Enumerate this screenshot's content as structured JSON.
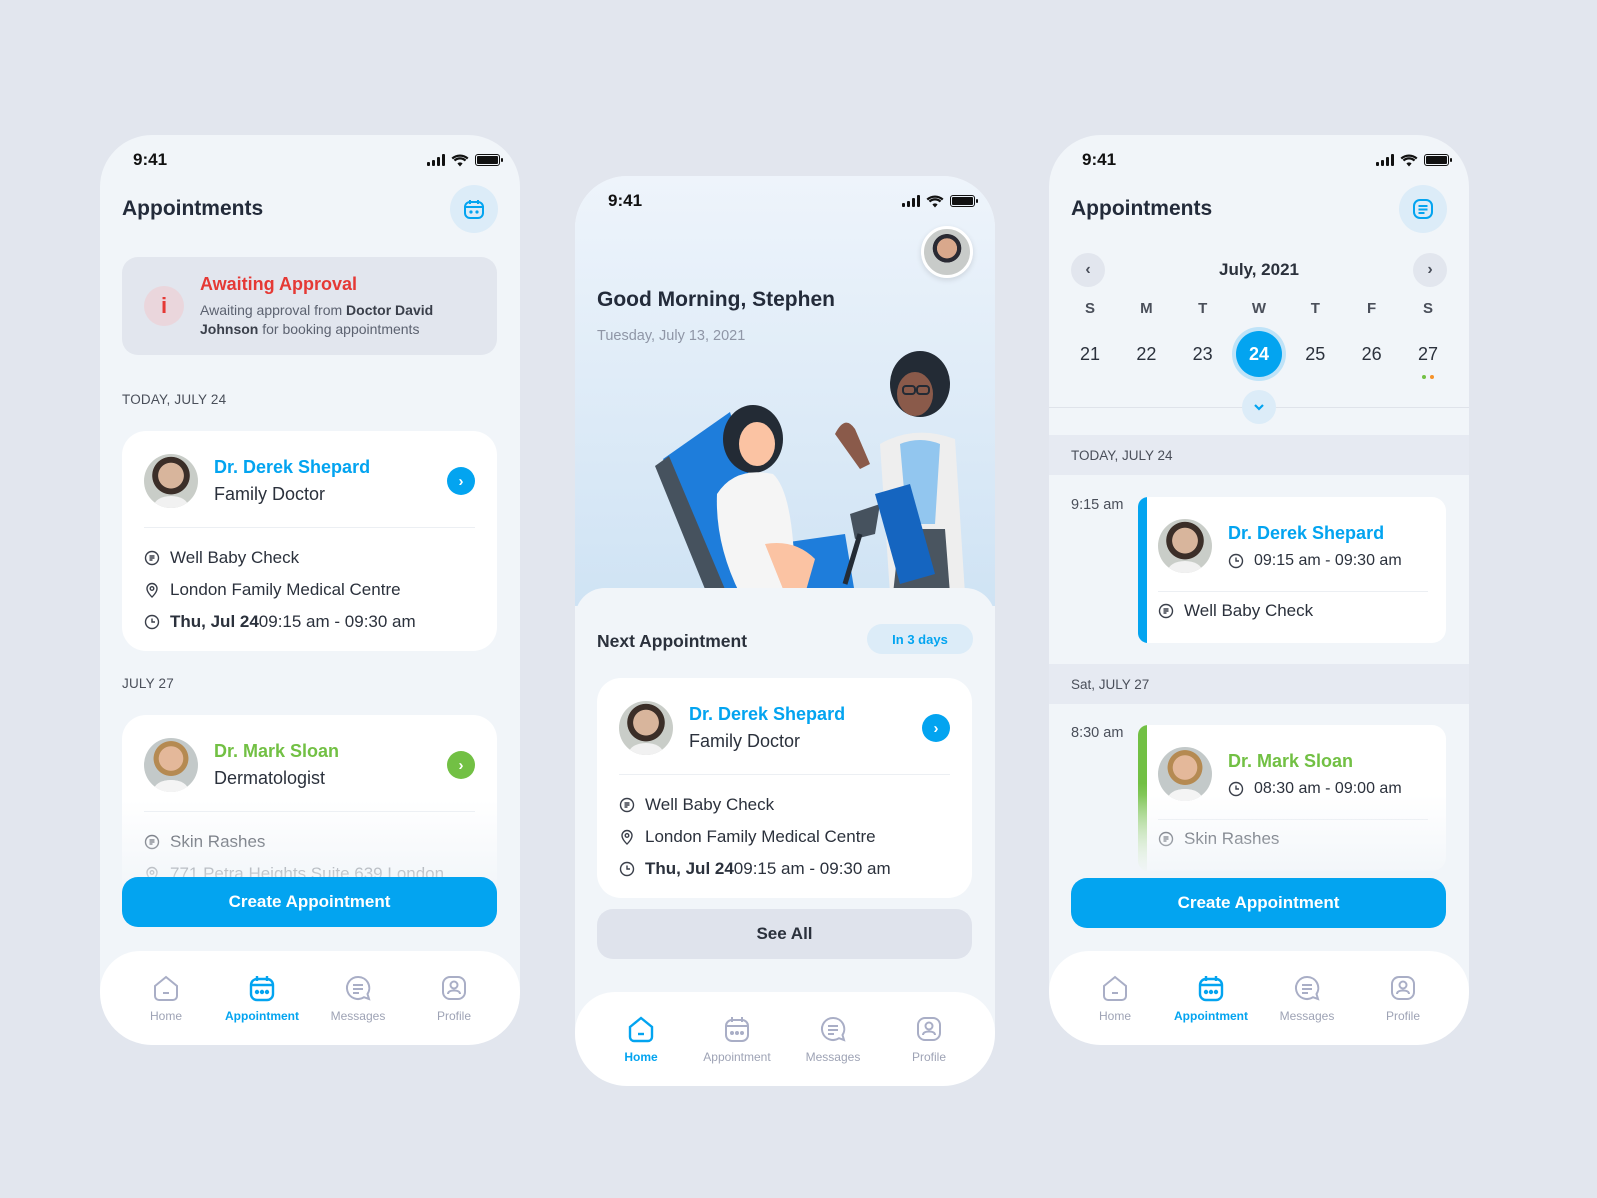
{
  "colors": {
    "accent": "#03a4f0",
    "green": "#72c044",
    "red": "#e53935",
    "orange": "#f5922a",
    "text": "#232b3a",
    "muted": "#9ea3b5"
  },
  "status_bar": {
    "time": "9:41"
  },
  "tabs": [
    {
      "label": "Home",
      "icon": "home-icon"
    },
    {
      "label": "Appointment",
      "icon": "calendar-icon"
    },
    {
      "label": "Messages",
      "icon": "message-icon"
    },
    {
      "label": "Profile",
      "icon": "profile-icon"
    }
  ],
  "screen1": {
    "title": "Appointments",
    "header_icon": "calendar-icon",
    "alert": {
      "title": "Awaiting Approval",
      "text_pre": "Awaiting approval from ",
      "text_bold": "Doctor David Johnson",
      "text_post": " for booking appointments"
    },
    "sections": [
      {
        "label": "TODAY, JULY 24",
        "card": {
          "doctor": "Dr. Derek Shepard",
          "specialty": "Family Doctor",
          "reason": "Well Baby Check",
          "location": "London Family Medical Centre",
          "date_bold": "Thu, Jul 24",
          "time": " 09:15 am - 09:30 am"
        }
      },
      {
        "label": "JULY 27",
        "card": {
          "doctor": "Dr. Mark Sloan",
          "specialty": "Dermatologist",
          "reason": "Skin Rashes",
          "location": "771 Petra Heights Suite 639 London"
        }
      }
    ],
    "create_button": "Create Appointment",
    "active_tab": "Appointment"
  },
  "screen2": {
    "greeting": "Good Morning, Stephen",
    "date": "Tuesday, July 13, 2021",
    "next_title": "Next Appointment",
    "badge": "In 3 days",
    "card": {
      "doctor": "Dr. Derek Shepard",
      "specialty": "Family Doctor",
      "reason": "Well Baby Check",
      "location": "London Family Medical Centre",
      "date_bold": "Thu, Jul 24",
      "time": " 09:15 am - 09:30 am"
    },
    "see_all": "See All",
    "active_tab": "Home"
  },
  "screen3": {
    "title": "Appointments",
    "header_icon": "list-icon",
    "month": "July, 2021",
    "weekdays": [
      "S",
      "M",
      "T",
      "W",
      "T",
      "F",
      "S"
    ],
    "dates": [
      "21",
      "22",
      "23",
      "24",
      "25",
      "26",
      "27"
    ],
    "selected_date": "24",
    "sections": [
      {
        "label": "TODAY, JULY 24",
        "time": "9:15 am",
        "doctor": "Dr. Derek Shepard",
        "range": "09:15 am - 09:30 am",
        "reason": "Well Baby Check"
      },
      {
        "label": "Sat, JULY 27",
        "time": "8:30 am",
        "doctor": "Dr. Mark Sloan",
        "range": "08:30 am - 09:00 am",
        "reason": "Skin Rashes"
      }
    ],
    "create_button": "Create Appointment",
    "active_tab": "Appointment"
  }
}
